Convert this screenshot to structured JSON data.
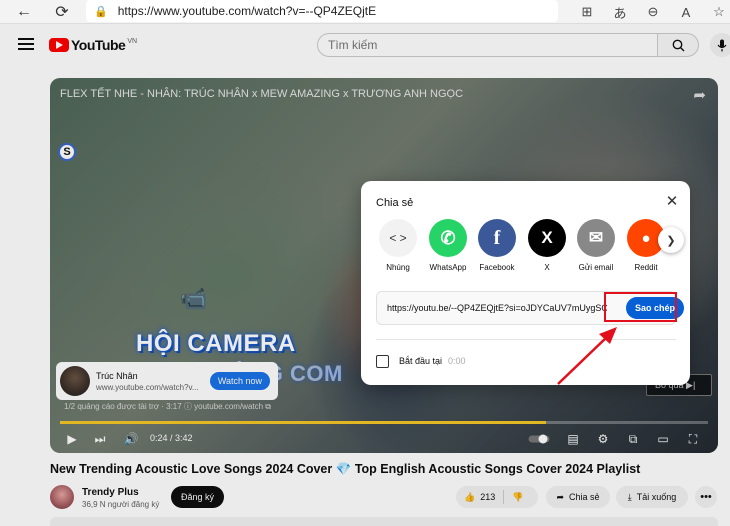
{
  "browser": {
    "url": "https://www.youtube.com/watch?v=--QP4ZEQjtE",
    "back_icon": "←",
    "refresh_icon": "⟳"
  },
  "header": {
    "logo_text": "YouTube",
    "country": "VN",
    "search_placeholder": "Tìm kiếm"
  },
  "video": {
    "overlay_title": "FLEX TẾT NHE - NHÂN: TRÚC NHÂN x MEW AMAZING x TRƯƠNG ANH NGỌC",
    "caption_line1": "HỘI CAMERA",
    "caption_line2": "CHẠY CÙNG COM",
    "badge": "S",
    "ad": {
      "name": "Trúc Nhân",
      "url": "www.youtube.com/watch?v...",
      "watch_label": "Watch now",
      "info": "1/2 quảng cáo được tài trợ · 3:17  ⓘ  youtube.com/watch ⧉"
    },
    "skip_label": "Bỏ qua ▶|",
    "time": "0:24 / 3:42",
    "progress": 0.75
  },
  "details": {
    "title": "New Trending Acoustic Love Songs 2024 Cover",
    "title_suffix": "Top English Acoustic Songs Cover 2024 Playlist",
    "gem": "💎",
    "channel_name": "Trendy Plus",
    "channel_subs": "36,9 N người đăng ký",
    "subscribe_label": "Đăng ký",
    "likes": "213",
    "share_label": "Chia sẻ",
    "download_label": "Tải xuống",
    "more_label": "•••"
  },
  "share_dialog": {
    "title": "Chia sẻ",
    "targets": [
      {
        "label": "Nhúng",
        "glyph": "< >",
        "color": "#f2f2f2"
      },
      {
        "label": "WhatsApp",
        "glyph": "✆",
        "color": "#25d366"
      },
      {
        "label": "Facebook",
        "glyph": "f",
        "color": "#3b5998"
      },
      {
        "label": "X",
        "glyph": "X",
        "color": "#000000"
      },
      {
        "label": "Gửi email",
        "glyph": "✉",
        "color": "#888888"
      },
      {
        "label": "Reddit",
        "glyph": "●",
        "color": "#ff4500"
      }
    ],
    "link": "https://youtu.be/--QP4ZEQjtE?si=oJDYCaUV7mUygSO",
    "copy_label": "Sao chép",
    "start_label": "Bắt đầu tại",
    "start_time": "0:00"
  }
}
